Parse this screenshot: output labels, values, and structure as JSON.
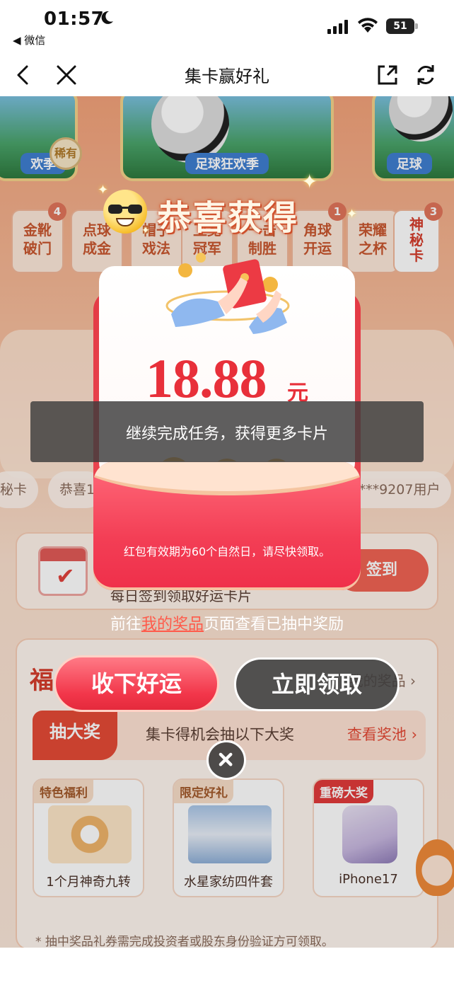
{
  "status_bar": {
    "time": "01:57",
    "back_app": "◀ 微信",
    "battery": "51"
  },
  "nav": {
    "title": "集卡赢好礼"
  },
  "background": {
    "cards_top": [
      "欢季",
      "足球狂欢季",
      "足球"
    ],
    "rare_badge": "稀有",
    "tiles": [
      {
        "label": "金靴\n破门",
        "count": "4"
      },
      {
        "label": "点球\n成金",
        "count": ""
      },
      {
        "label": "帽子\n戏法",
        "count": ""
      },
      {
        "label": "卫冕\n冠军",
        "count": ""
      },
      {
        "label": "一击\n制胜",
        "count": ""
      },
      {
        "label": "角球\n开运",
        "count": "1"
      },
      {
        "label": "荣耀\n之杯",
        "count": ""
      },
      {
        "label": "神\n秘\n卡",
        "count": "3"
      }
    ],
    "ticker": [
      "秘卡",
      "恭喜1",
      "5****9207用户"
    ],
    "checkin_text": "每日签到领取好运卡片",
    "checkin_button": "签到",
    "fu_label": "福",
    "my_prize_link": "我的奖品 ›",
    "big_prize_tab": "抽大奖",
    "big_prize_desc": "集卡得机会抽以下大奖",
    "view_pool": "查看奖池 ›",
    "prizes": [
      {
        "tag": "特色福利",
        "name": "1个月神奇九转"
      },
      {
        "tag": "限定好礼",
        "name": "水星家纺四件套"
      },
      {
        "tag": "重磅大奖",
        "name": "iPhone17"
      }
    ],
    "footnote": "* 抽中奖品礼券需完成投资者或股东身份验证方可领取。"
  },
  "modal": {
    "title": "恭喜获得",
    "amount": "18.88",
    "unit": "元",
    "validity": "红包有效期为60个自然日，请尽快领取。",
    "prize_line_prefix": "前往",
    "prize_line_link": "我的奖品",
    "prize_line_suffix": "页面查看已抽中奖励",
    "accept_button": "收下好运",
    "claim_button": "立即领取"
  },
  "toast": {
    "message": "继续完成任务，获得更多卡片"
  },
  "colors": {
    "accent_red": "#e8303a",
    "bg_peach": "#f6c0a0"
  }
}
